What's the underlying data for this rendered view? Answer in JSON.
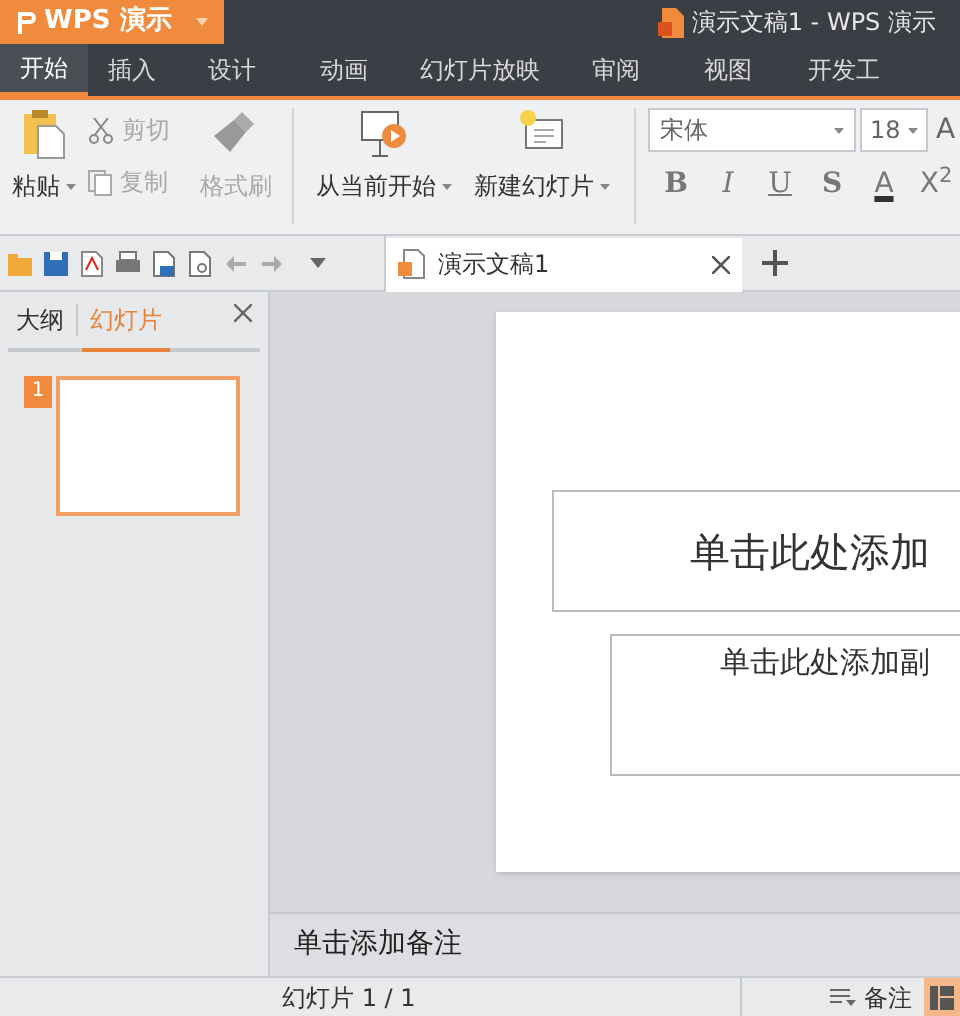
{
  "app_button": {
    "label": "WPS 演示"
  },
  "window": {
    "title": "演示文稿1 - WPS 演示"
  },
  "menu_tabs": [
    {
      "label": "开始",
      "selected": true
    },
    {
      "label": "插入",
      "selected": false
    },
    {
      "label": "设计",
      "selected": false
    },
    {
      "label": "动画",
      "selected": false
    },
    {
      "label": "幻灯片放映",
      "selected": false
    },
    {
      "label": "审阅",
      "selected": false
    },
    {
      "label": "视图",
      "selected": false
    },
    {
      "label": "开发工",
      "selected": false
    }
  ],
  "ribbon": {
    "paste": {
      "label": "粘贴",
      "disabled": false
    },
    "clipboard": [
      {
        "kind": "cut",
        "label": "剪切",
        "disabled": true
      },
      {
        "kind": "copy",
        "label": "复制",
        "disabled": true
      }
    ],
    "format_painter": {
      "label": "格式刷",
      "disabled": true
    },
    "slideshow": {
      "label": "从当前开始"
    },
    "new_slide": {
      "label": "新建幻灯片"
    },
    "font": {
      "value": "宋体"
    },
    "size": {
      "value": "18"
    },
    "grow": "A",
    "format_buttons": [
      {
        "kind": "bold",
        "label": "B"
      },
      {
        "kind": "italic",
        "label": "I"
      },
      {
        "kind": "underline",
        "label": "U"
      },
      {
        "kind": "shadow",
        "label": "S"
      },
      {
        "kind": "color",
        "label": "A"
      },
      {
        "kind": "superscript",
        "label": "X$^{2}$"
      }
    ]
  },
  "document_tab": {
    "title": "演示文稿1"
  },
  "side_panel": {
    "tabs": [
      {
        "label": "大纲",
        "selected": false
      },
      {
        "label": "幻灯片",
        "selected": true
      }
    ],
    "thumbnails": [
      {
        "number": "1",
        "selected": true
      }
    ]
  },
  "slide": {
    "title_placeholder": "单击此处添加",
    "subtitle_placeholder": "单击此处添加副"
  },
  "notes": {
    "placeholder": "单击添加备注"
  },
  "status_bar": {
    "slide_count": "幻灯片 1 / 1",
    "notes_button": "备注"
  }
}
